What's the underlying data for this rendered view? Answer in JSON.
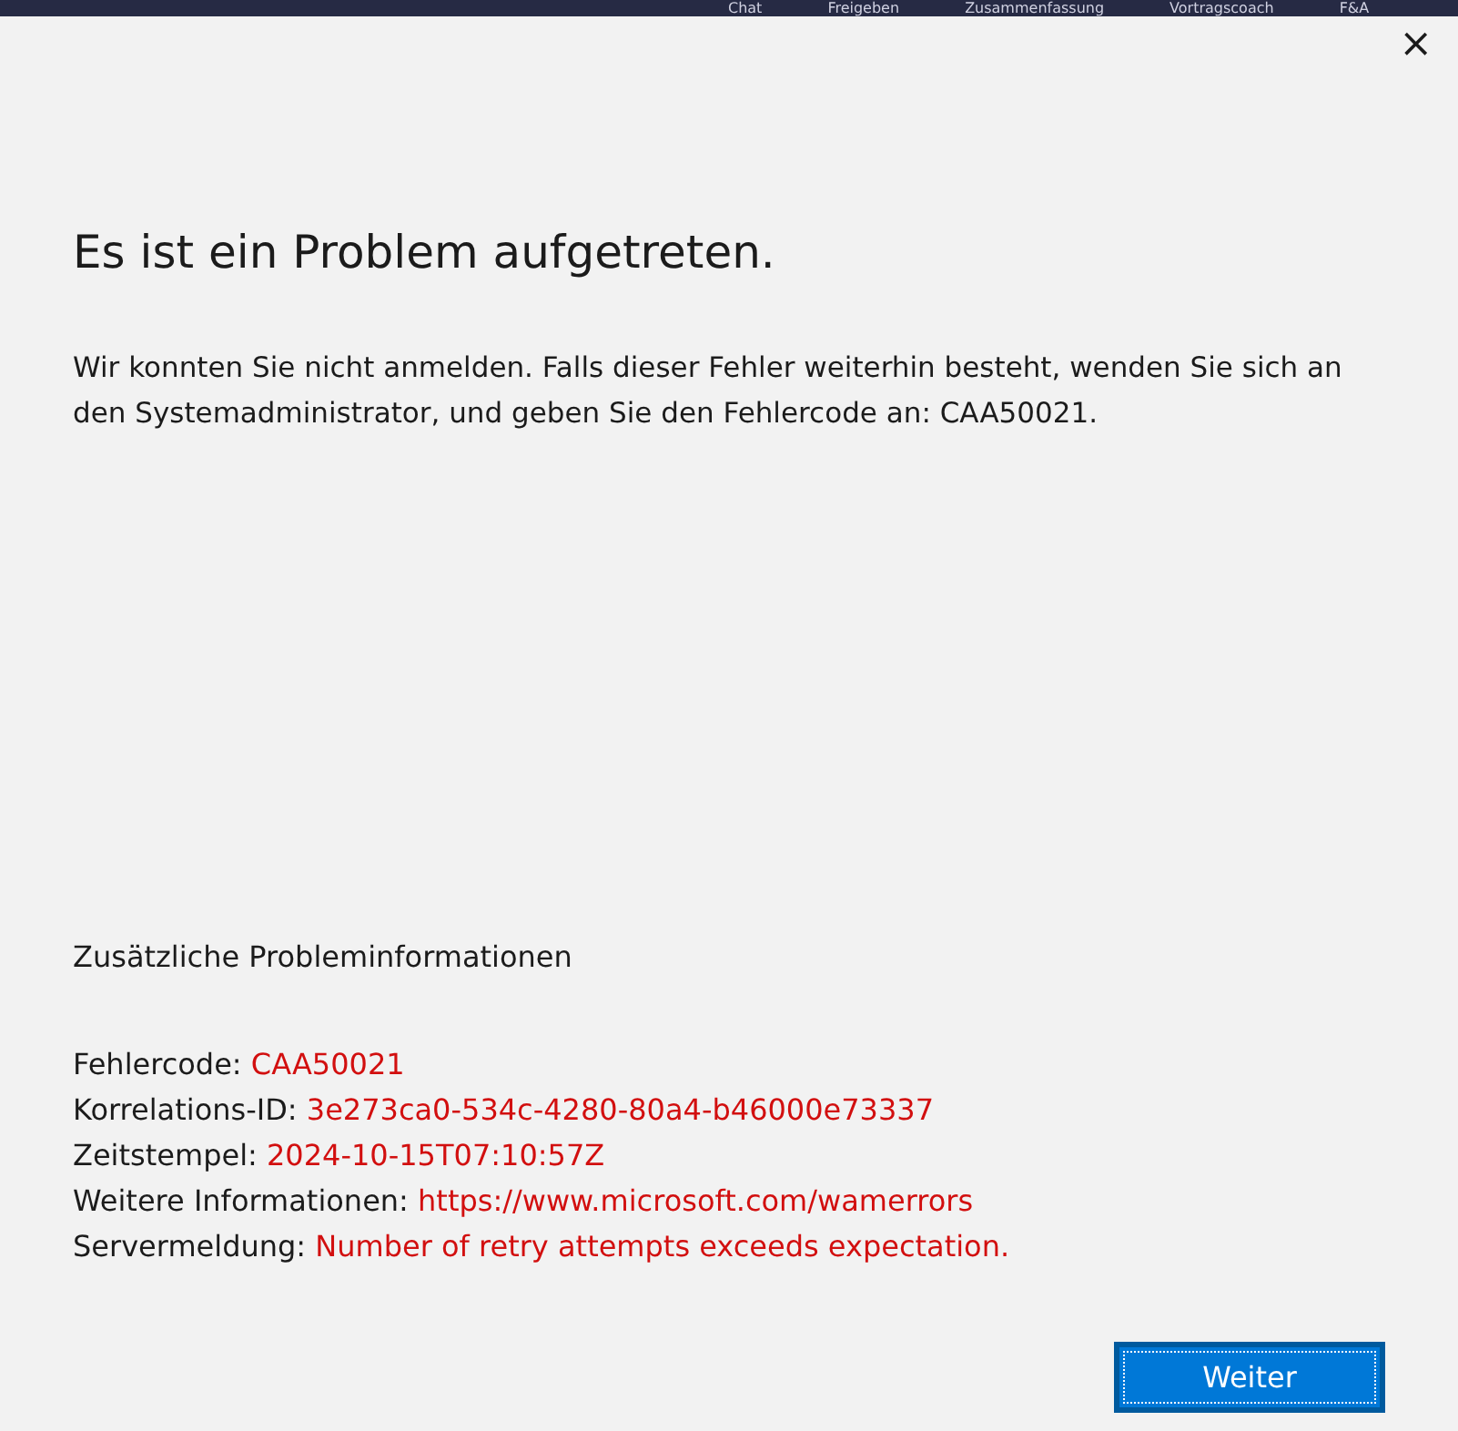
{
  "background_tabs": [
    "Chat",
    "Freigeben",
    "Zusammenfassung",
    "Vortragscoach",
    "F&A"
  ],
  "dialog": {
    "close": "×",
    "title": "Es ist ein Problem aufgetreten.",
    "message": "Wir konnten Sie nicht anmelden. Falls dieser Fehler weiterhin besteht, wenden Sie sich an den Systemadministrator, und geben Sie den Fehlercode an: CAA50021.",
    "details_heading": "Zusätzliche Probleminformationen",
    "details": [
      {
        "label": "Fehlercode:",
        "value": "CAA50021"
      },
      {
        "label": "Korrelations-ID:",
        "value": "3e273ca0-534c-4280-80a4-b46000e73337"
      },
      {
        "label": "Zeitstempel:",
        "value": "2024-10-15T07:10:57Z"
      },
      {
        "label": "Weitere Informationen:",
        "value": "https://www.microsoft.com/wamerrors"
      },
      {
        "label": "Servermeldung:",
        "value": "Number of retry attempts exceeds expectation."
      }
    ],
    "button": "Weiter"
  }
}
